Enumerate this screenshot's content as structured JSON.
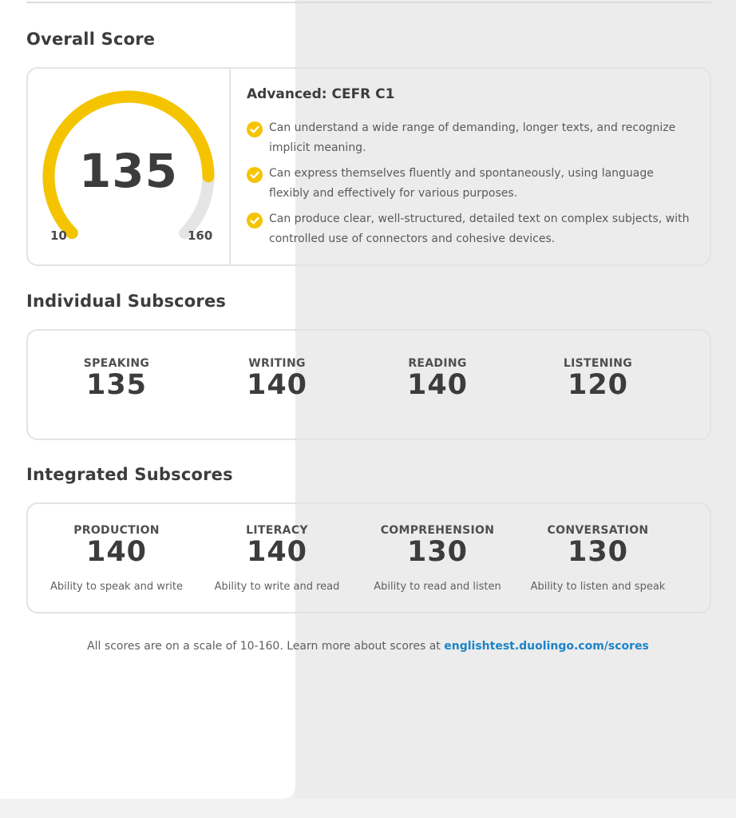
{
  "overall": {
    "title": "Overall Score",
    "score": "135",
    "score_fraction": 0.833,
    "min": "10",
    "max": "160",
    "level": "Advanced: CEFR C1",
    "descriptions": [
      "Can understand a wide range of demanding, longer texts, and recognize implicit meaning.",
      "Can express themselves fluently and spontaneously, using language flexibly and effectively for various purposes.",
      "Can produce clear, well-structured, detailed text on complex subjects, with controlled use of connectors and cohesive devices."
    ]
  },
  "individual": {
    "title": "Individual Subscores",
    "items": [
      {
        "label": "SPEAKING",
        "value": "135"
      },
      {
        "label": "WRITING",
        "value": "140"
      },
      {
        "label": "READING",
        "value": "140"
      },
      {
        "label": "LISTENING",
        "value": "120"
      }
    ]
  },
  "integrated": {
    "title": "Integrated Subscores",
    "items": [
      {
        "label": "PRODUCTION",
        "value": "140",
        "desc": "Ability to speak and write"
      },
      {
        "label": "LITERACY",
        "value": "140",
        "desc": "Ability to write and read"
      },
      {
        "label": "COMPREHENSION",
        "value": "130",
        "desc": "Ability to read and listen"
      },
      {
        "label": "CONVERSATION",
        "value": "130",
        "desc": "Ability to listen and speak"
      }
    ]
  },
  "footer": {
    "text": "All scores are on a scale of 10-160. Learn more about scores at ",
    "link": "englishtest.duolingo.com/scores"
  },
  "colors": {
    "gauge_fill": "#f5c400",
    "gauge_track": "#e5e5e5",
    "link": "#1b84c8"
  }
}
